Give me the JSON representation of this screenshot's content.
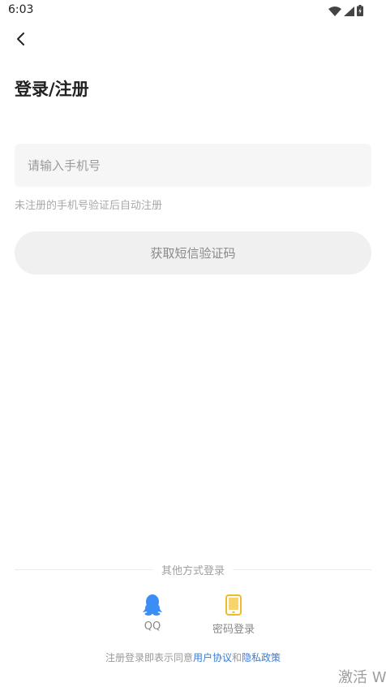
{
  "status_bar": {
    "time": "6:03"
  },
  "header": {
    "title": "登录/注册"
  },
  "form": {
    "phone_placeholder": "请输入手机号",
    "phone_value": "",
    "hint": "未注册的手机号验证后自动注册",
    "sms_button_label": "获取短信验证码"
  },
  "other_login": {
    "divider_text": "其他方式登录",
    "options": [
      {
        "label": "QQ",
        "icon": "qq-penguin-icon",
        "color": "#3a8ef6"
      },
      {
        "label": "密码登录",
        "icon": "tablet-icon",
        "color": "#f2b928"
      }
    ]
  },
  "agreement": {
    "prefix": "注册登录即表示同意",
    "user_agreement": "用户协议",
    "and": "和",
    "privacy_policy": "隐私政策"
  },
  "watermark": {
    "text": "激活 W"
  },
  "colors": {
    "link": "#3a7bd5",
    "input_bg": "#f6f6f6",
    "button_bg": "#f0f0f0"
  }
}
